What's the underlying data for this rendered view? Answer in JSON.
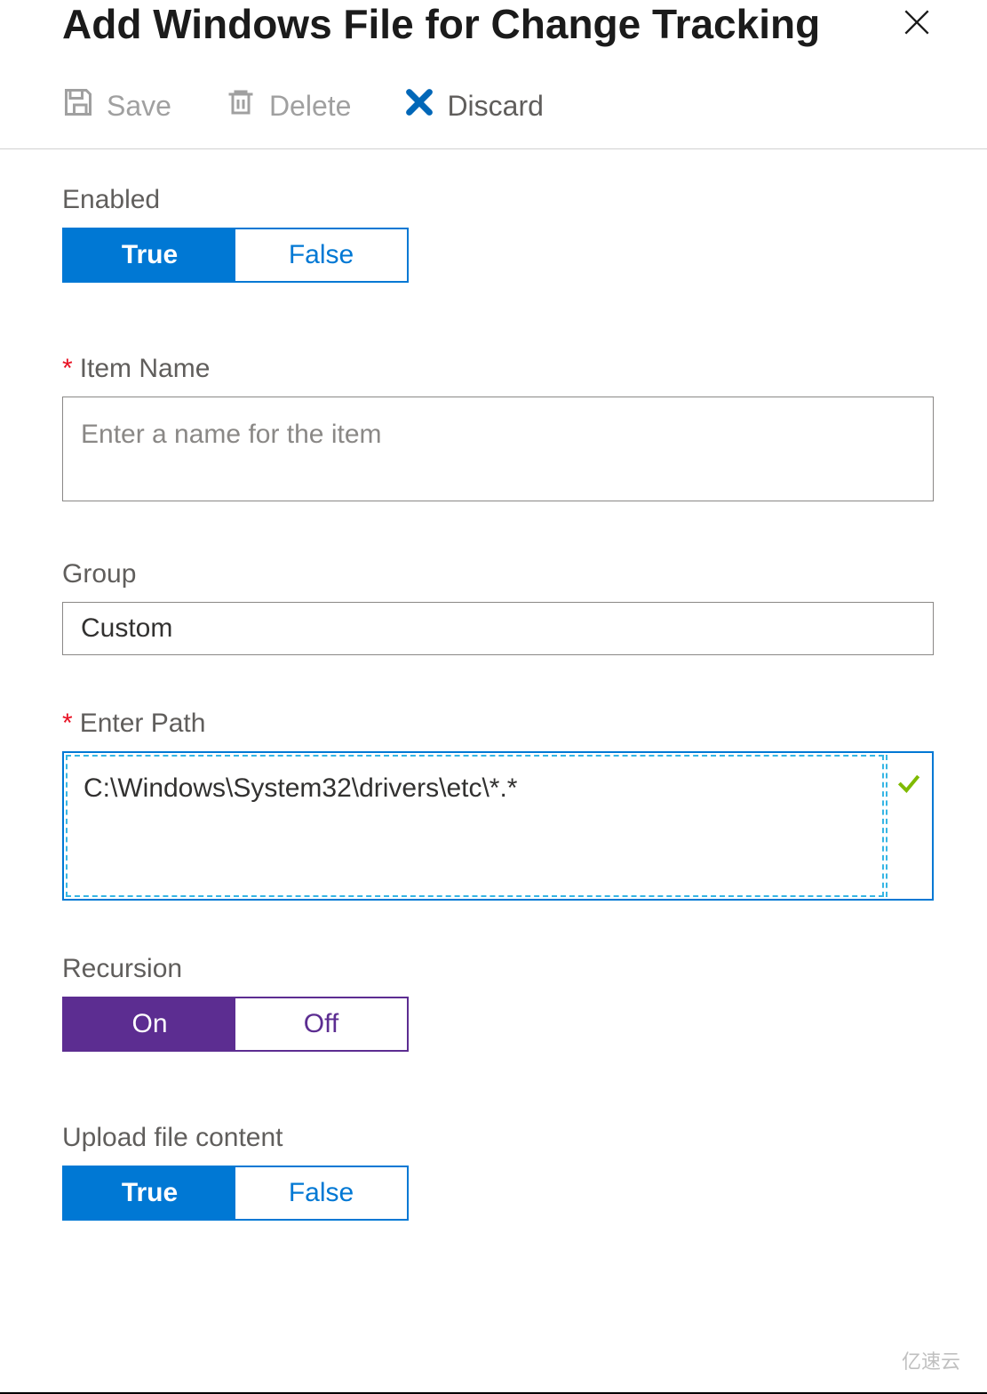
{
  "header": {
    "title": "Add Windows File for Change Tracking"
  },
  "toolbar": {
    "save_label": "Save",
    "delete_label": "Delete",
    "discard_label": "Discard"
  },
  "form": {
    "enabled": {
      "label": "Enabled",
      "true_label": "True",
      "false_label": "False",
      "value": "True"
    },
    "item_name": {
      "label": "Item Name",
      "placeholder": "Enter a name for the item",
      "value": ""
    },
    "group": {
      "label": "Group",
      "value": "Custom"
    },
    "path": {
      "label": "Enter Path",
      "value": "C:\\Windows\\System32\\drivers\\etc\\*.*"
    },
    "recursion": {
      "label": "Recursion",
      "on_label": "On",
      "off_label": "Off",
      "value": "On"
    },
    "upload": {
      "label": "Upload file content",
      "true_label": "True",
      "false_label": "False",
      "value": "True"
    }
  },
  "watermark": "亿速云"
}
